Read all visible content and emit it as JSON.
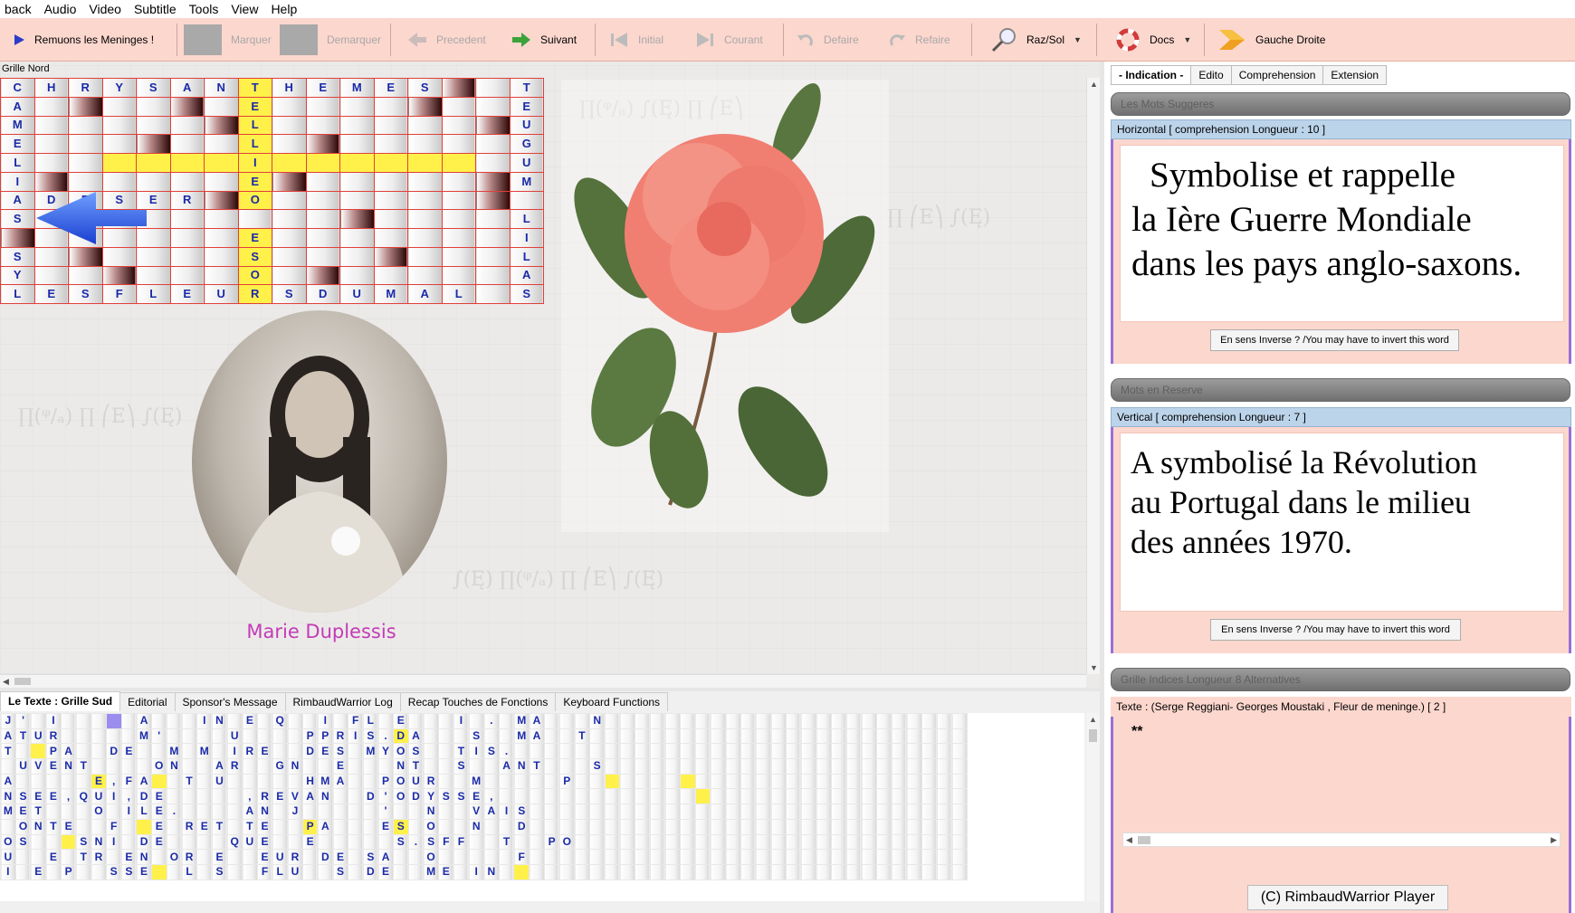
{
  "menu": [
    "back",
    "Audio",
    "Video",
    "Subtitle",
    "Tools",
    "View",
    "Help"
  ],
  "toolbar": {
    "play_label": "Remuons les Meninges !",
    "marquer": "Marquer",
    "demarquer": "Demarquer",
    "precedent": "Precedent",
    "suivant": "Suivant",
    "initial": "Initial",
    "courant": "Courant",
    "defaire": "Defaire",
    "refaire": "Refaire",
    "razsol": "Raz/Sol",
    "docs": "Docs",
    "gauche_droite": "Gauche Droite"
  },
  "north": {
    "caption": "Grille Nord",
    "rows": [
      [
        "C",
        "H",
        "R",
        "Y",
        "S",
        "A",
        "N",
        "T",
        "H",
        "E",
        "M",
        "E",
        "S",
        "#",
        "",
        "T"
      ],
      [
        "A",
        "",
        "#",
        "",
        "",
        "#",
        "",
        "E",
        "",
        "",
        "",
        "",
        "#",
        "",
        "",
        "E"
      ],
      [
        "M",
        "",
        "",
        "",
        "",
        "",
        "#",
        "L",
        "",
        "",
        "",
        "",
        "",
        "",
        "#",
        "U"
      ],
      [
        "E",
        "",
        "",
        "",
        "#",
        "",
        "",
        "L",
        "",
        "#",
        "",
        "",
        "",
        "",
        "",
        "G"
      ],
      [
        "L",
        "",
        "",
        "",
        "",
        "",
        "",
        "I",
        "",
        "",
        "",
        "",
        "",
        "",
        "",
        "U"
      ],
      [
        "I",
        "#",
        "",
        "",
        "",
        "",
        "",
        "E",
        "#",
        "",
        "",
        "",
        "",
        "",
        "#",
        "M"
      ],
      [
        "A",
        "D",
        "E",
        "S",
        "E",
        "R",
        "#",
        "O",
        "",
        "",
        "",
        "",
        "",
        "",
        "#",
        ""
      ],
      [
        "S",
        "",
        "",
        "",
        "",
        "",
        "",
        "",
        "",
        "",
        "#",
        "",
        "",
        "",
        "",
        "L"
      ],
      [
        "#",
        "",
        "",
        "",
        "",
        "",
        "",
        "E",
        "",
        "",
        "",
        "",
        "",
        "",
        "",
        "I"
      ],
      [
        "S",
        "",
        "#",
        "",
        "",
        "",
        "",
        "S",
        "",
        "",
        "",
        "#",
        "",
        "",
        "",
        "L"
      ],
      [
        "Y",
        "",
        "",
        "#",
        "",
        "",
        "",
        "O",
        "",
        "#",
        "",
        "",
        "",
        "",
        "",
        "A"
      ],
      [
        "L",
        "E",
        "S",
        "F",
        "L",
        "E",
        "U",
        "R",
        "S",
        "D",
        "U",
        "M",
        "A",
        "L",
        "",
        "S"
      ]
    ]
  },
  "portrait_caption": "Marie Duplessis",
  "bottom_tabs": [
    "Le Texte : Grille Sud",
    "Editorial",
    "Sponsor's Message",
    "RimbaudWarrior Log",
    "Recap Touches de Fonctions",
    "Keyboard Functions"
  ],
  "south_rows": [
    "J'_I_____A___IN_E_Q__I_FL_E___I_._MA___N",
    "ATUR_____M'____U____PPRIS.DA___S__MA__T_",
    "T__PA__DE__M_M_IRE__DES_MYOS__TIS.____",
    "_UVENT____ON__AR__GN__E___NT__S__ANT___S",
    "A_____E,FA__T_U_____HMA__POUR__M_____P_",
    "NSEE,QUI,DE_____,REVAN__D'ODYSSE,_",
    "MET___O_ILE.____AN_J_____'__N__VAIS_",
    "_ONTE__F__E_RET_TE__PA___ES_O__N__D____",
    "OS___SNI_DE____QUE__E_____S.SFF__T__PO",
    "U__E_TR_EN_OR_E__EUR_DE_SA__O_____F__",
    "I_E_P__SSE__L_S__FLU__S_DE__ME_IN_"
  ],
  "right_tabs": [
    "- Indication -",
    "Edito",
    "Comprehension",
    "Extension"
  ],
  "bars": [
    "Les Mots Suggeres",
    "Mots en Reserve",
    "Grille Indices Longueur 8 Alternatives"
  ],
  "horizontal": {
    "header": "Horizontal [ comprehension  Longueur : 10 ]",
    "lines": [
      "Symbolise et rappelle",
      "la Ière Guerre Mondiale",
      "dans les pays anglo-saxons."
    ],
    "invert": "En sens Inverse ? /You may have to invert this word"
  },
  "vertical": {
    "header": "Vertical [ comprehension  Longueur : 7 ]",
    "lines": [
      "A symbolisé la Révolution",
      "au Portugal dans le milieu",
      "des années 1970."
    ],
    "invert": "En sens Inverse ? /You may have to invert this word"
  },
  "texte": {
    "header": "Texte :  (Serge Reggiani- Georges Moustaki , Fleur de meninge.)  [ 2 ]",
    "body": "**"
  },
  "copyright": "(C) RimbaudWarrior Player",
  "colors": {
    "toolbar": "#fcd7ce",
    "grid_letter": "#1a2aa8",
    "grid_border": "#e0403a",
    "highlight": "#fff14a",
    "caption": "#c43ab8",
    "card_accent": "#9970d8"
  }
}
